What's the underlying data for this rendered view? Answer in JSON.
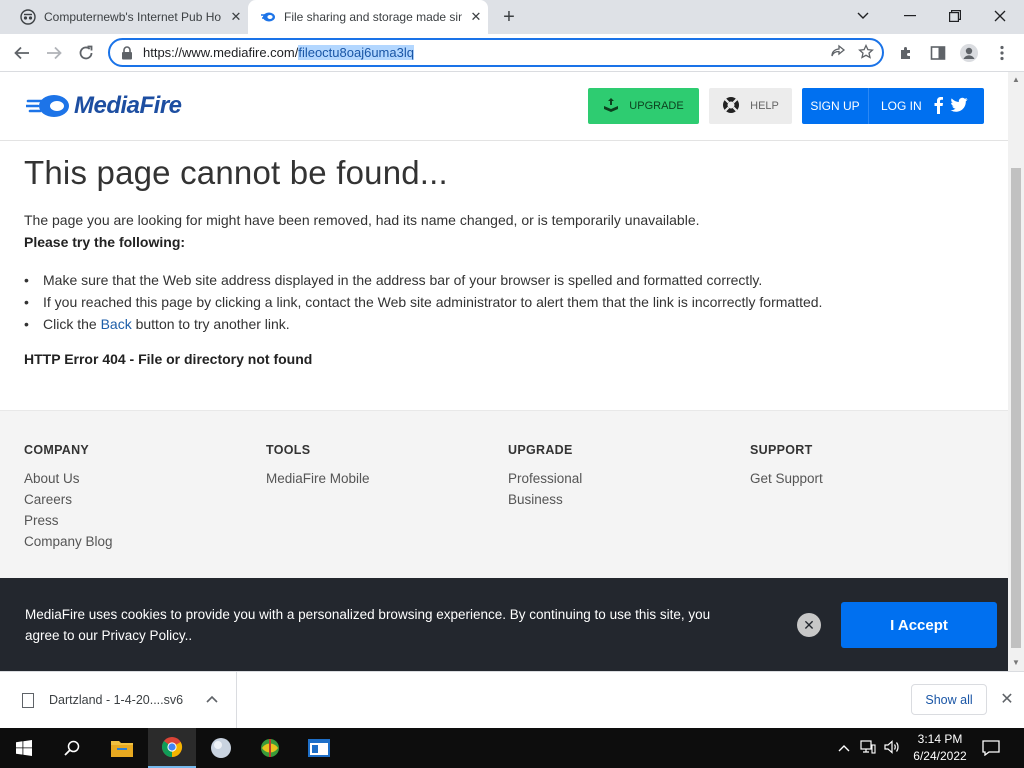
{
  "browser": {
    "tabs": [
      {
        "title": "Computernewb's Internet Pub Ho",
        "active": false
      },
      {
        "title": "File sharing and storage made sim",
        "active": true
      }
    ],
    "url_base": "https://www.mediafire.com/",
    "url_selected": "fileoctu8oaj6uma3lq"
  },
  "header": {
    "logo_text": "MediaFire",
    "upgrade_label": "UPGRADE",
    "help_label": "HELP",
    "signup_label": "SIGN UP",
    "login_label": "LOG IN"
  },
  "error": {
    "title": "This page cannot be found...",
    "description": "The page you are looking for might have been removed, had its name changed, or is temporarily unavailable.",
    "try_heading": "Please try the following:",
    "item1": "Make sure that the Web site address displayed in the address bar of your browser is spelled and formatted correctly.",
    "item2": "If you reached this page by clicking a link, contact the Web site administrator to alert them that the link is incorrectly formatted.",
    "item3_pre": "Click the ",
    "item3_link": "Back",
    "item3_post": " button to try another link.",
    "code": "HTTP Error 404 - File or directory not found"
  },
  "footer": {
    "company": {
      "heading": "COMPANY",
      "links": [
        "About Us",
        "Careers",
        "Press",
        "Company Blog"
      ]
    },
    "tools": {
      "heading": "TOOLS",
      "links": [
        "MediaFire Mobile"
      ]
    },
    "upgrade": {
      "heading": "UPGRADE",
      "links": [
        "Professional",
        "Business"
      ]
    },
    "support": {
      "heading": "SUPPORT",
      "links": [
        "Get Support"
      ]
    }
  },
  "cookie": {
    "text": "MediaFire uses cookies to provide you with a personalized browsing experience. By continuing to use this site, you agree to our Privacy Policy..",
    "accept_label": "I Accept"
  },
  "downloads": {
    "file_name": "Dartzland - 1-4-20....sv6",
    "show_all_label": "Show all"
  },
  "taskbar": {
    "time": "3:14 PM",
    "date": "6/24/2022"
  },
  "colors": {
    "brand_blue": "#0070f0",
    "upgrade_green": "#2ecc71",
    "cookie_bg": "#23272e"
  }
}
